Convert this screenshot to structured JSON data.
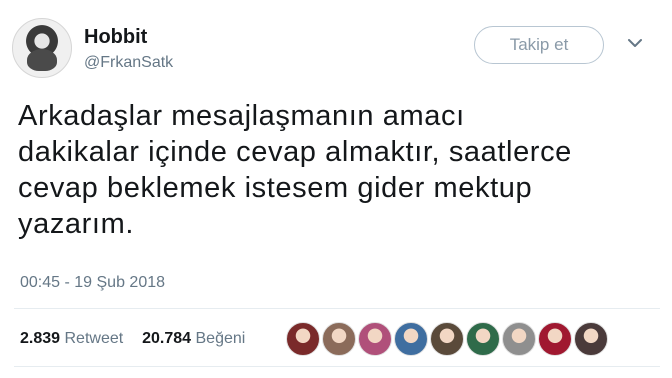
{
  "user": {
    "display_name": "Hobbit",
    "handle": "@FrkanSatk"
  },
  "follow_button": {
    "label": "Takip et"
  },
  "tweet": {
    "lines": [
      "Arkadaşlar mesajlaşmanın amacı",
      "dakikalar içinde cevap almaktır, saatlerce",
      "cevap beklemek istesem gider mektup",
      "yazarım."
    ],
    "timestamp": "00:45 - 19 Şub 2018"
  },
  "stats": {
    "retweet_count": "2.839",
    "retweet_label": "Retweet",
    "like_count": "20.784",
    "like_label": "Beğeni"
  },
  "liker_avatars": [
    {
      "name": "liker-1",
      "color": "#7a2a2a"
    },
    {
      "name": "liker-2",
      "color": "#8b6b5a"
    },
    {
      "name": "liker-3",
      "color": "#b0507a"
    },
    {
      "name": "liker-4",
      "color": "#3f6ea0"
    },
    {
      "name": "liker-5",
      "color": "#5a4a3a"
    },
    {
      "name": "liker-6",
      "color": "#2f6b4a"
    },
    {
      "name": "liker-7",
      "color": "#8f8f8f"
    },
    {
      "name": "liker-8",
      "color": "#a01830"
    },
    {
      "name": "liker-9",
      "color": "#4a3a3a"
    }
  ]
}
